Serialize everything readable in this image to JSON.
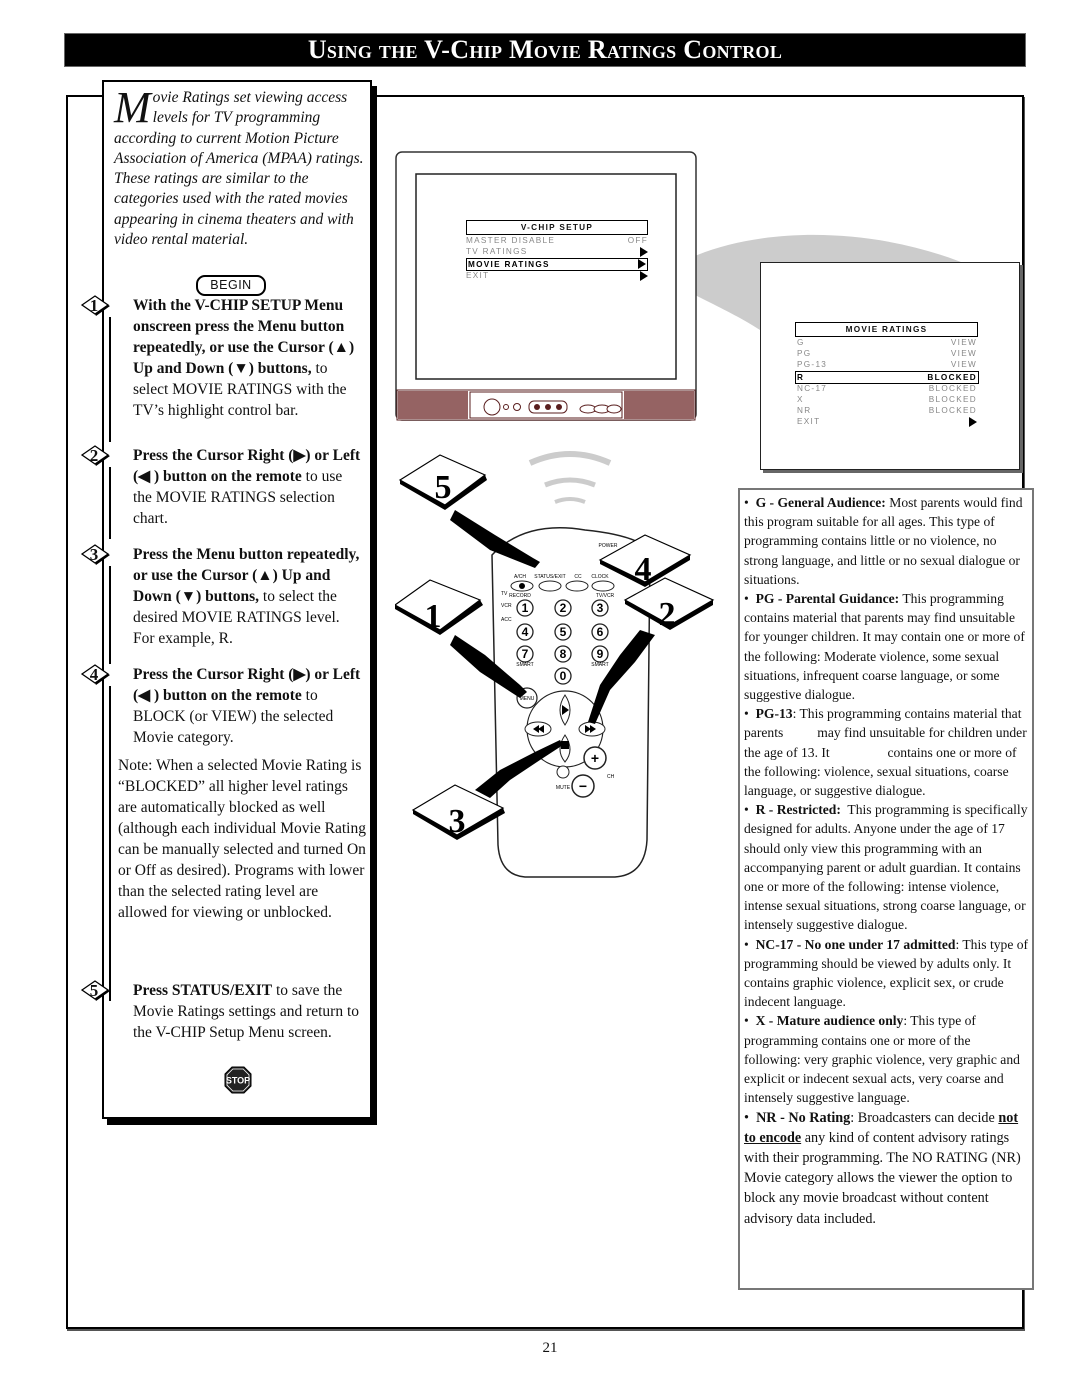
{
  "title": "Using the V-Chip Movie Ratings Control",
  "intro": {
    "dropcap": "M",
    "text": "ovie Ratings set viewing access levels for TV programming according to current Motion Picture Association of America (MPAA) ratings. These ratings are similar to the categories used with the rated movies appearing in cinema theaters and with video rental material."
  },
  "begin_label": "BEGIN",
  "steps": [
    {
      "num": "1",
      "bold": "With the V-CHIP SETUP Menu onscreen press the Menu button repeatedly, or use the Cursor (▲) Up and Down (▼) buttons,",
      "rest": " to select MOVIE RATINGS with the TV’s highlight control bar."
    },
    {
      "num": "2",
      "bold": "Press the Cursor Right (▶) or Left (◀ ) button on the remote",
      "rest": " to use the MOVIE RATINGS selection chart."
    },
    {
      "num": "3",
      "bold": "Press the Menu button repeatedly, or use the Cursor (▲) Up and Down (▼) buttons,",
      "rest": " to select the desired MOVIE RATINGS level. For example, R."
    },
    {
      "num": "4",
      "bold": "Press the Cursor Right (▶) or Left (◀ ) button on the remote",
      "rest": " to BLOCK (or VIEW) the selected Movie category."
    },
    {
      "num": "5",
      "bold": "Press STATUS/EXIT",
      "rest": " to save the Movie Ratings settings and return to the V-CHIP Setup Menu screen."
    }
  ],
  "note": "Note: When a selected Movie Rating is “BLOCKED” all higher level ratings are automatically blocked as well (although each individual Movie Rating can be manually selected and turned On or Off as desired). Programs with lower than the selected rating level are allowed for viewing or unblocked.",
  "stop_label": "STOP",
  "vchip_menu": {
    "title": "V-CHIP SETUP",
    "items": [
      {
        "label": "MASTER DISABLE",
        "value": "OFF",
        "arrow": false,
        "selected": false
      },
      {
        "label": "TV RATINGS",
        "value": "",
        "arrow": true,
        "selected": false
      },
      {
        "label": "MOVIE RATINGS",
        "value": "",
        "arrow": true,
        "selected": true
      },
      {
        "label": "EXIT",
        "value": "",
        "arrow": true,
        "selected": false
      }
    ]
  },
  "movie_ratings_menu": {
    "title": "MOVIE RATINGS",
    "items": [
      {
        "label": "G",
        "value": "VIEW",
        "selected": false
      },
      {
        "label": "PG",
        "value": "VIEW",
        "selected": false
      },
      {
        "label": "PG-13",
        "value": "VIEW",
        "selected": false
      },
      {
        "label": "R",
        "value": "BLOCKED",
        "selected": true
      },
      {
        "label": "NC-17",
        "value": "BLOCKED",
        "selected": false
      },
      {
        "label": "X",
        "value": "BLOCKED",
        "selected": false
      },
      {
        "label": "NR",
        "value": "BLOCKED",
        "selected": false
      },
      {
        "label": "EXIT",
        "value": "",
        "arrow": true,
        "selected": false
      }
    ]
  },
  "remote": {
    "labels": {
      "power": "POWER",
      "ach": "A/CH",
      "status_exit": "STATUS/EXIT",
      "cc": "CC",
      "clock": "CLOCK",
      "record": "RECORD",
      "tv_vcr": "TV/VCR",
      "tv": "TV",
      "vcr": "VCR",
      "acc": "ACC",
      "smart_left": "SMART",
      "smart_right": "SMART",
      "menu": "MENU",
      "mute": "MUTE",
      "ch": "CH"
    },
    "digits": [
      "1",
      "2",
      "3",
      "4",
      "5",
      "6",
      "7",
      "8",
      "9",
      "0"
    ],
    "callouts": [
      "5",
      "4",
      "1",
      "2",
      "3"
    ]
  },
  "descriptions": [
    {
      "bold": "G - General Audience:",
      "text": " Most parents would find this program suitable for all ages. This type of programming contains little or no violence, no strong language, and little or no sexual dialogue or situations."
    },
    {
      "bold": "PG - Parental Guidance:",
      "text": " This programming contains material that parents may find unsuitable for younger children. It may contain one or more of the following: Moderate violence, some sexual situations, infrequent coarse language, or some suggestive dialogue."
    },
    {
      "bold": "PG-13",
      "text": ": This programming contains material that parents          may find unsuitable for children under the age of 13. It                 contains one or more of the following: violence, sexual situations, coarse language, or suggestive dialogue."
    },
    {
      "bold": "R - Restricted:",
      "text": "  This programming is specifically designed for adults. Anyone under the age of 17 should only view this programming with an accompanying parent or adult guardian. It contains one or more of the following: intense violence, intense sexual situations, strong coarse language, or intensely suggestive dialogue."
    },
    {
      "bold": "NC-17 - No one under 17 admitted",
      "text": ": This type of programming should be viewed by adults only. It contains graphic violence, explicit sex, or crude indecent language."
    },
    {
      "bold": "X - Mature audience only",
      "text": ": This type of programming contains one or more of the following: very graphic violence, very graphic and explicit or indecent sexual acts, very coarse and intensely suggestive language."
    },
    {
      "bold": "NR - No Rating",
      "text": ": Broadcasters can decide ",
      "underline": "not to encode",
      "text2": " any kind of content advisory ratings with their programming. The NO RATING (NR) Movie category allows the viewer the option to block any movie broadcast without content advisory data included."
    }
  ],
  "page_number": "21"
}
